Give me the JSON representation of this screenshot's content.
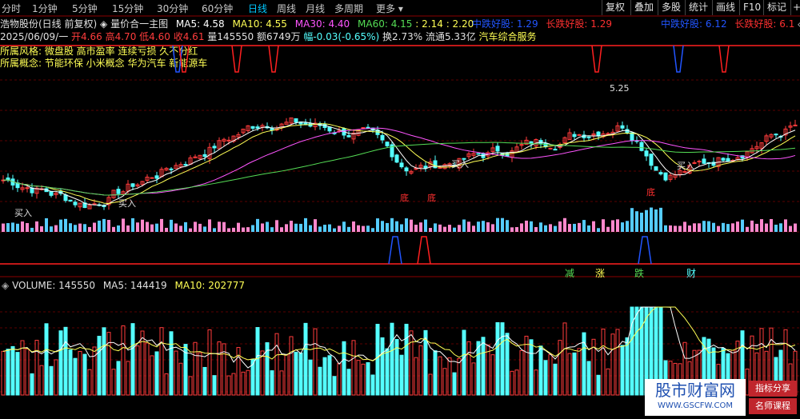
{
  "tabs": [
    "分时",
    "1分钟",
    "5分钟",
    "15分钟",
    "30分钟",
    "60分钟",
    "日线",
    "周线",
    "月线",
    "多周期",
    "更多"
  ],
  "active_tab": "日线",
  "right_buttons": [
    "复权",
    "叠加",
    "多股",
    "统计",
    "画线",
    "F10",
    "标记"
  ],
  "chart_title": "浩物股份(日线 前复权)",
  "chart_mode": "量价合一主图",
  "ma": {
    "ma5": "MA5: 4.58",
    "ma10": "MA10: 4.55",
    "ma30": "MA30: 4.40",
    "ma60": "MA60: 4.15",
    "extra1": "2.14",
    "extra2": "2.20"
  },
  "signals_left": {
    "mid": "中跌好股: 1.29",
    "long": "长跌好股: 1.29"
  },
  "signals_right": {
    "mid": "中跌好股: 6.12",
    "long": "长跌好股: 6.1"
  },
  "quote": {
    "date": "2025/06/09/一",
    "open": "开4.66",
    "high": "高4.70",
    "low": "低4.60",
    "close": "收4.61",
    "volume": "量145550",
    "amount": "额6749万",
    "change": "幅-0.03(-0.65%)",
    "turnover": "换2.73%",
    "float_cap": "流通5.33亿",
    "industry": "汽车综合服务"
  },
  "concept1": "所属风格: 微盘股 高市盈率 连续亏损 久不分红",
  "concept2": "所属概念: 节能环保 小米概念 华为汽车 新能源车",
  "annotations": {
    "peak": "5.25",
    "buy1": "买入",
    "buy2": "买入",
    "buy3": "买入",
    "buy4": "买入",
    "bottom1": "底",
    "bottom2": "底",
    "bottom3": "底"
  },
  "band_labels": [
    "减",
    "涨",
    "跌",
    "财"
  ],
  "volume_header": {
    "vol": "VOLUME: 145550",
    "ma5": "MA5: 144419",
    "ma10": "MA10: 202777"
  },
  "watermark": {
    "name": "股市财富网",
    "url": "WWW.GSCFW.COM",
    "tag1": "指标分享",
    "tag2": "名师课程"
  },
  "colors": {
    "up": "#ff3c3c",
    "down": "#54ffff",
    "ma5": "#ffffff",
    "ma10": "#ffff55",
    "ma30": "#ff55ff",
    "ma60": "#55dd55",
    "active_tab": "#00c8ff"
  }
}
